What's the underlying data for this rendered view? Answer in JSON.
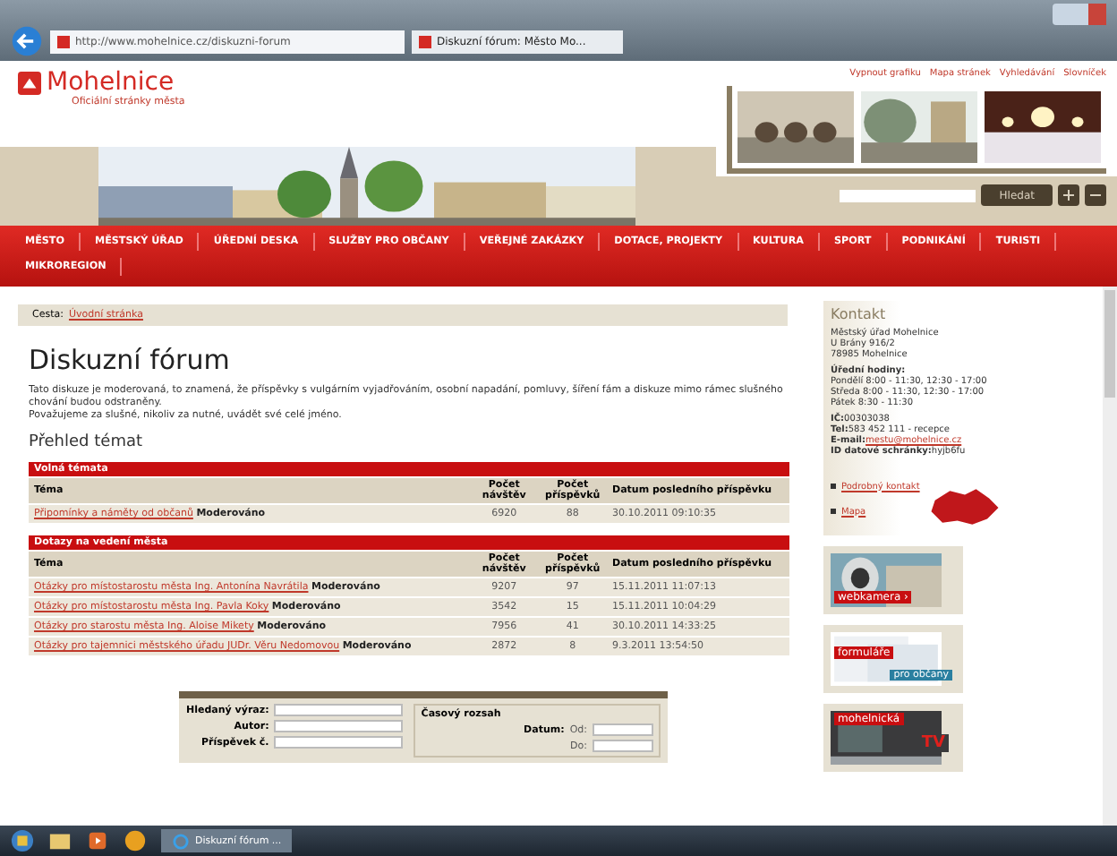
{
  "browser": {
    "address": "http://www.mohelnice.cz/diskuzni-forum",
    "tab": "Diskuzní fórum: Město Mo..."
  },
  "header": {
    "logo": "Mohelnice",
    "subtitle": "Oficiální stránky města",
    "links": [
      "Vypnout grafiku",
      "Mapa stránek",
      "Vyhledávání",
      "Slovníček"
    ],
    "search_button": "Hledat"
  },
  "nav": [
    "MĚSTO",
    "MĚSTSKÝ ÚŘAD",
    "ÚŘEDNÍ DESKA",
    "SLUŽBY PRO OBČANY",
    "VEŘEJNÉ ZAKÁZKY",
    "DOTACE, PROJEKTY",
    "KULTURA",
    "SPORT",
    "PODNIKÁNÍ",
    "TURISTI",
    "MIKROREGION"
  ],
  "breadcrumb": {
    "label": "Cesta:",
    "link": "Úvodní stránka"
  },
  "title": "Diskuzní fórum",
  "intro": [
    "Tato diskuze je moderovaná, to znamená, že příspěvky s vulgárním vyjadřováním, osobní napadání, pomluvy, šíření fám a diskuze mimo rámec slušného chování budou odstraněny.",
    "Považujeme za slušné, nikoliv za nutné, uvádět své celé jméno."
  ],
  "overview_title": "Přehled témat",
  "sections": [
    {
      "title": "Volná témata",
      "columns": [
        "Téma",
        "Počet návštěv",
        "Počet příspěvků",
        "Datum posledního příspěvku"
      ],
      "rows": [
        {
          "topic": "Připomínky a náměty od občanů",
          "note": "Moderováno",
          "visits": "6920",
          "posts": "88",
          "date": "30.10.2011 09:10:35"
        }
      ]
    },
    {
      "title": "Dotazy na vedení města",
      "columns": [
        "Téma",
        "Počet návštěv",
        "Počet příspěvků",
        "Datum posledního příspěvku"
      ],
      "rows": [
        {
          "topic": "Otázky pro místostarostu města Ing. Antonína Navrátila",
          "note": "Moderováno",
          "visits": "9207",
          "posts": "97",
          "date": "15.11.2011 11:07:13"
        },
        {
          "topic": "Otázky pro místostarostu města Ing. Pavla Koky",
          "note": "Moderováno",
          "visits": "3542",
          "posts": "15",
          "date": "15.11.2011 10:04:29"
        },
        {
          "topic": "Otázky pro starostu města Ing. Aloise Mikety",
          "note": "Moderováno",
          "visits": "7956",
          "posts": "41",
          "date": "30.10.2011 14:33:25"
        },
        {
          "topic": "Otázky pro tajemnici městského úřadu JUDr. Věru Nedomovou",
          "note": "Moderováno",
          "visits": "2872",
          "posts": "8",
          "date": "9.3.2011 13:54:50"
        }
      ]
    }
  ],
  "search_form": {
    "fields": [
      "Hledaný výraz:",
      "Autor:",
      "Příspěvek č."
    ],
    "range_title": "Časový rozsah",
    "date_label": "Datum:",
    "from": "Od:",
    "to": "Do:"
  },
  "sidebar": {
    "title": "Kontakt",
    "address": [
      "Městský úřad Mohelnice",
      "U Brány 916/2",
      "78985 Mohelnice"
    ],
    "hours_title": "Úřední hodiny:",
    "hours": [
      "Pondělí 8:00 - 11:30, 12:30 - 17:00",
      "Středa 8:00 - 11:30, 12:30 - 17:00",
      "Pátek 8:30 - 11:30"
    ],
    "details": [
      {
        "label": "IČ:",
        "value": "00303038"
      },
      {
        "label": "Tel:",
        "value": "583 452 111 - recepce"
      },
      {
        "label": "E-mail:",
        "value": "mestu@mohelnice.cz",
        "kind": "link"
      },
      {
        "label": "ID datové schránky:",
        "value": "hyjb6fu"
      }
    ],
    "links": [
      "Podrobný kontakt",
      "Mapa"
    ],
    "banners": [
      {
        "kind": "webcam",
        "label": "webkamera ›"
      },
      {
        "kind": "forms",
        "label": "formuláře",
        "sub": "pro občany"
      },
      {
        "kind": "tv",
        "label": "mohelnická",
        "sub": "TV"
      }
    ]
  },
  "taskbar": {
    "task": "Diskuzní fórum ..."
  }
}
